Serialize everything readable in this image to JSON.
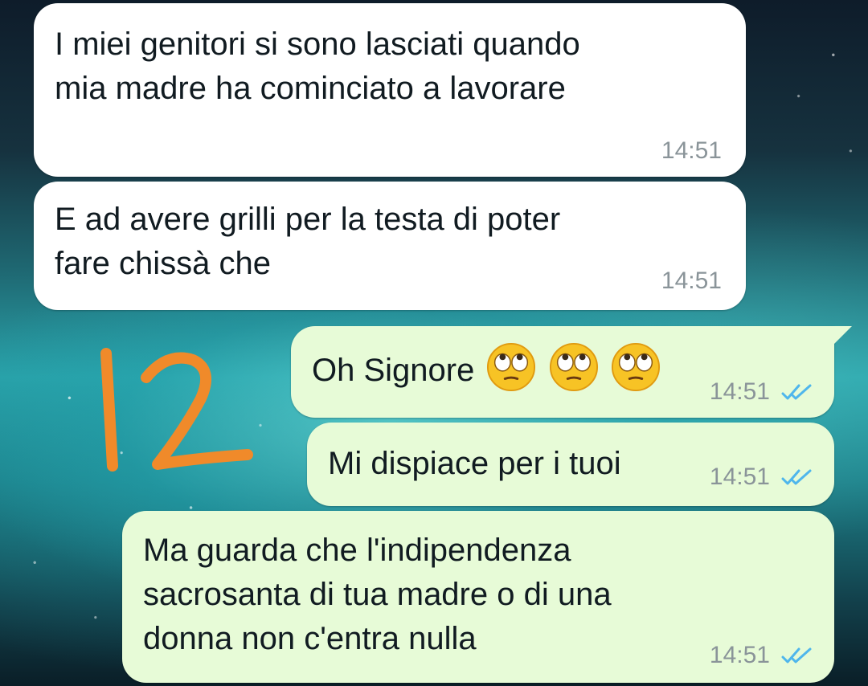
{
  "messages": [
    {
      "direction": "incoming",
      "lines": [
        "I miei genitori si sono lasciati quando",
        "mia madre ha cominciato a lavorare"
      ],
      "time": "14:51"
    },
    {
      "direction": "incoming",
      "lines": [
        "E ad avere grilli per la testa di poter",
        "fare chissà che"
      ],
      "time": "14:51"
    },
    {
      "direction": "outgoing",
      "text": "Oh Signore",
      "emojis": [
        "face-with-rolling-eyes",
        "face-with-rolling-eyes",
        "face-with-rolling-eyes"
      ],
      "time": "14:51",
      "status": "read"
    },
    {
      "direction": "outgoing",
      "text": "Mi dispiace per i tuoi",
      "time": "14:51",
      "status": "read"
    },
    {
      "direction": "outgoing",
      "lines": [
        "Ma guarda che l'indipendenza",
        "sacrosanta di tua madre o di una",
        "donna non c'entra nulla"
      ],
      "time": "14:51",
      "status": "read"
    }
  ],
  "annotation": {
    "text": "12",
    "color": "#f08a2a"
  },
  "colors": {
    "incoming_bubble": "#ffffff",
    "outgoing_bubble": "#e7fbd7",
    "read_tick": "#4fb6ec",
    "timestamp": "#8a9499"
  }
}
